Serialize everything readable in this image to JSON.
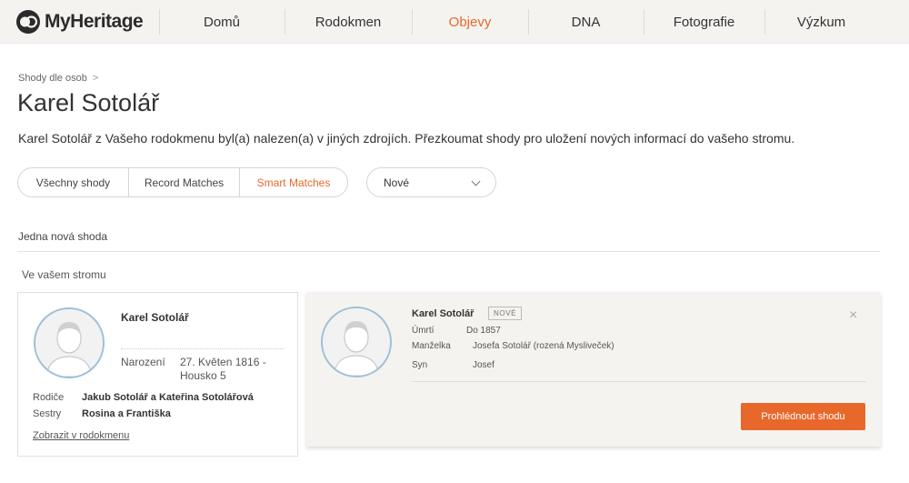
{
  "brand": {
    "name": "MyHeritage",
    "accent": "#e8682c"
  },
  "nav": {
    "items": [
      {
        "label": "Domů",
        "active": false
      },
      {
        "label": "Rodokmen",
        "active": false
      },
      {
        "label": "Objevy",
        "active": true
      },
      {
        "label": "DNA",
        "active": false
      },
      {
        "label": "Fotografie",
        "active": false
      },
      {
        "label": "Výzkum",
        "active": false
      }
    ]
  },
  "breadcrumb": {
    "label": "Shody dle osob",
    "separator": ">"
  },
  "page": {
    "title": "Karel Sotolář",
    "description": "Karel Sotolář z Vašeho rodokmenu byl(a) nalezen(a) v jiných zdrojích. Přezkoumat shody pro uložení nových informací do vašeho stromu."
  },
  "filters": {
    "tabs": [
      {
        "label": "Všechny shody",
        "active": false
      },
      {
        "label": "Record Matches",
        "active": false
      },
      {
        "label": "Smart Matches",
        "active": true
      }
    ],
    "dropdown": {
      "value": "Nové",
      "icon": "chevron-down-icon"
    }
  },
  "results": {
    "count_label": "Jedna nová shoda",
    "tree_label": "Ve vašem stromu"
  },
  "tree_person": {
    "name": "Karel Sotolář",
    "birth_label": "Narození",
    "birth_value": "27. Květen 1816 - Housko 5",
    "parents_label": "Rodiče",
    "parents_value": "Jakub Sotolář a Kateřina Sotolářová",
    "siblings_label": "Sestry",
    "siblings_value": "Rosina a Františka",
    "tree_link": "Zobrazit v rodokmenu"
  },
  "match_person": {
    "name": "Karel Sotolář",
    "badge": "NOVÉ",
    "death_label": "Úmrtí",
    "death_value": "Do 1857",
    "spouse_label": "Manželka",
    "spouse_value": "Josefa Sotolář (rozená Mysliveček)",
    "child_label": "Syn",
    "child_value": "Josef",
    "close_icon": "close-icon",
    "review_button": "Prohlédnout shodu"
  }
}
